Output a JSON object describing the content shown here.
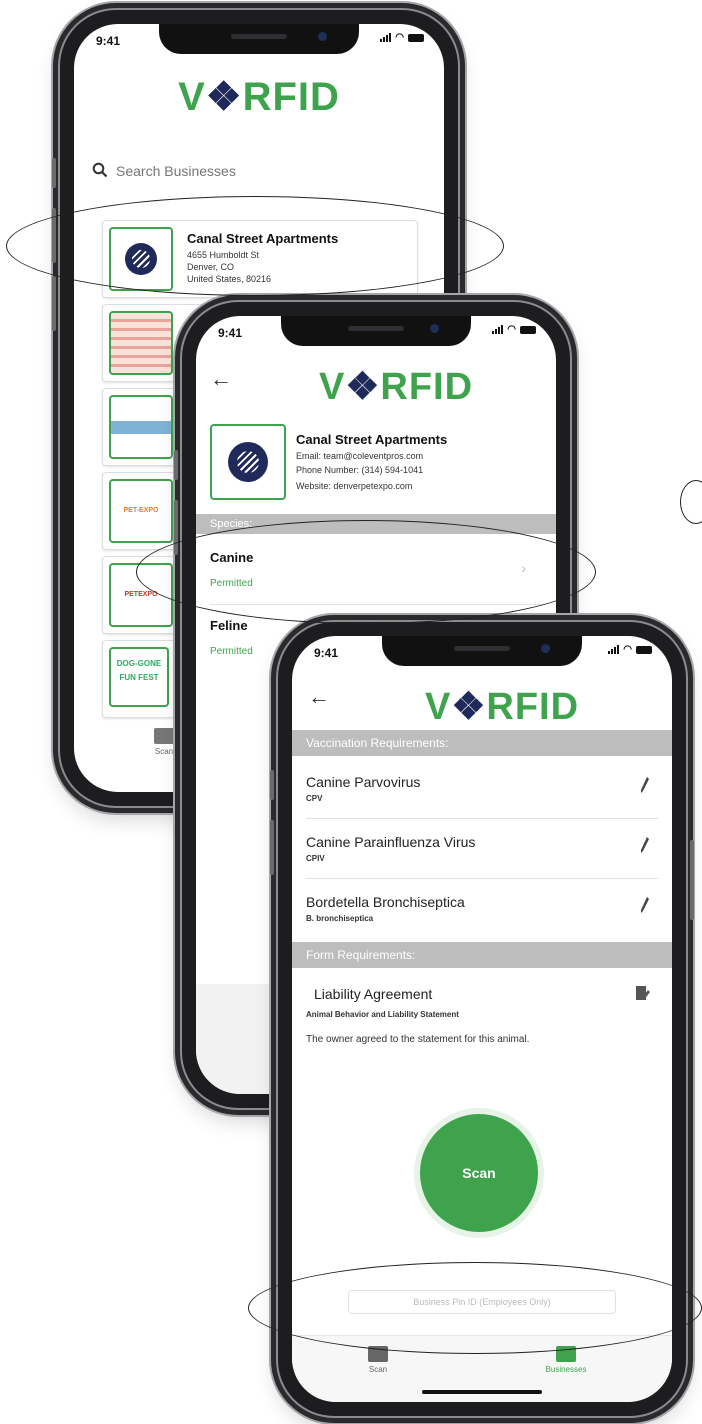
{
  "status_time": "9:41",
  "brand": {
    "left": "V",
    "paw": "❖",
    "right": "RFID"
  },
  "search": {
    "placeholder": "Search Businesses"
  },
  "business_list": [
    {
      "name": "Canal Street Apartments",
      "line1": "4655 Humboldt St",
      "line2": "Denver, CO",
      "line3": "United States, 80216"
    }
  ],
  "list_thumbnails": [
    {
      "label": "",
      "color": "#c0392b"
    },
    {
      "label": "",
      "color": "#3b8bc2"
    },
    {
      "label": "PET-EXPO",
      "color": "#e67e22"
    },
    {
      "label": "PETEXPO",
      "color": "#c0392b"
    },
    {
      "label": "DOG-GONE FUN FEST",
      "color": "#27ae60"
    }
  ],
  "detail": {
    "name": "Canal Street Apartments",
    "email": "Email: team@coleventpros.com",
    "phone": "Phone Number: (314) 594-1041",
    "website": "Website: denverpetexpo.com",
    "species_header": "Species:",
    "species": [
      {
        "name": "Canine",
        "status": "Permitted"
      },
      {
        "name": "Feline",
        "status": "Permitted"
      }
    ]
  },
  "requirements": {
    "vaccination_header": "Vaccination Requirements:",
    "vaccines": [
      {
        "name": "Canine Parvovirus",
        "abbr": "CPV"
      },
      {
        "name": "Canine Parainfluenza Virus",
        "abbr": "CPIV"
      },
      {
        "name": "Bordetella Bronchiseptica",
        "abbr": "B. bronchiseptica"
      }
    ],
    "form_header": "Form Requirements:",
    "form": {
      "name": "Liability Agreement",
      "subtitle": "Animal Behavior and Liability Statement",
      "statement": "The owner agreed to the statement for this animal."
    },
    "scan_label": "Scan",
    "business_only_label": "Business Pin ID (Employees Only)"
  },
  "tabs": [
    {
      "label": "Scan",
      "icon": "rss-scan-icon"
    },
    {
      "label": "Businesses",
      "icon": "store-icon"
    }
  ],
  "colors": {
    "accent": "#3fa34d",
    "navy": "#1f2a5a",
    "section": "#bdbdbd"
  }
}
